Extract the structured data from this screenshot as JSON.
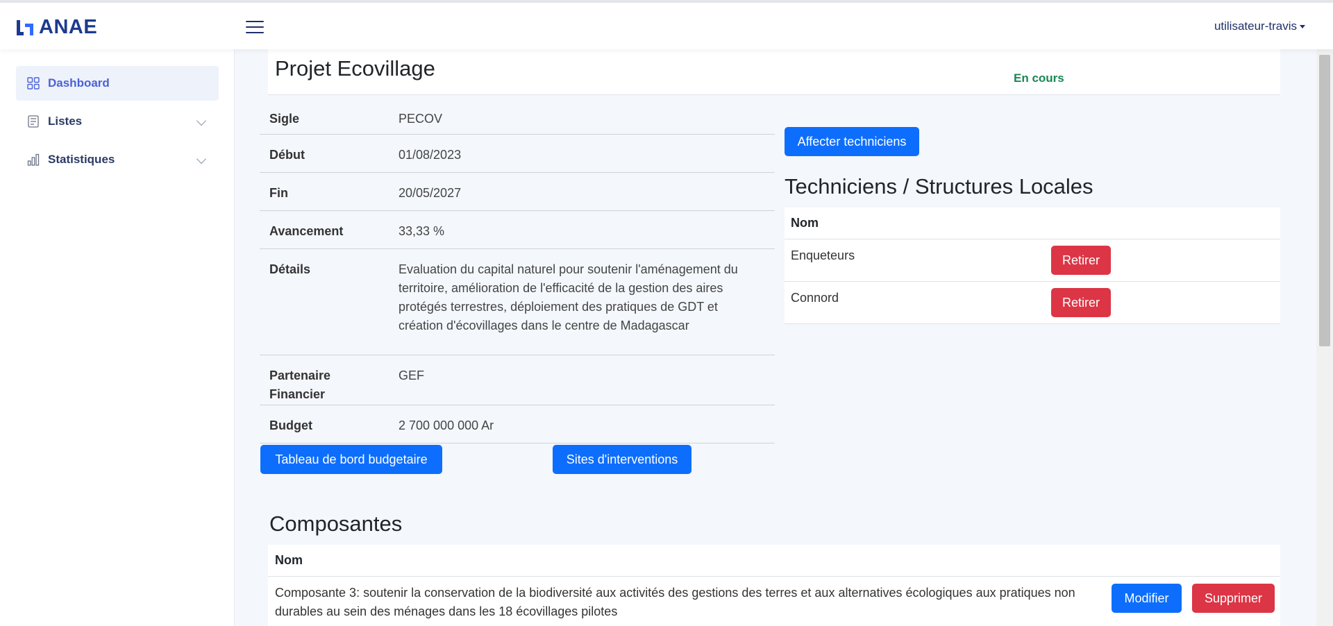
{
  "header": {
    "logo_text": "ANAE",
    "user_label": "utilisateur-travis"
  },
  "sidebar": {
    "items": [
      {
        "label": "Dashboard",
        "icon": "grid-icon",
        "active": true
      },
      {
        "label": "Listes",
        "icon": "list-icon",
        "expandable": true
      },
      {
        "label": "Statistiques",
        "icon": "bar-chart-icon",
        "expandable": true
      }
    ]
  },
  "project": {
    "title": "Projet Ecovillage",
    "status": "En cours",
    "fields": [
      {
        "label": "Sigle",
        "value": "PECOV"
      },
      {
        "label": "Début",
        "value": "01/08/2023"
      },
      {
        "label": "Fin",
        "value": "20/05/2027"
      },
      {
        "label": "Avancement",
        "value": "33,33 %"
      },
      {
        "label": "Détails",
        "value": "Evaluation du capital naturel pour soutenir l'aménagement du territoire, amélioration de l'efficacité de la gestion des aires protégés terrestres, déploiement des pratiques de GDT et création d'écovillages dans le centre de Madagascar"
      },
      {
        "label": "Partenaire Financier",
        "value": "GEF"
      },
      {
        "label": "Budget",
        "value": "2 700 000 000 Ar"
      }
    ],
    "buttons": {
      "budget_dashboard": "Tableau de bord budgetaire",
      "sites": "Sites d'interventions",
      "assign": "Affecter techniciens"
    }
  },
  "technicians": {
    "title": "Techniciens / Structures Locales",
    "column": "Nom",
    "remove_label": "Retirer",
    "rows": [
      {
        "name": "Enqueteurs"
      },
      {
        "name": "Connord"
      }
    ]
  },
  "components": {
    "title": "Composantes",
    "column": "Nom",
    "edit_label": "Modifier",
    "delete_label": "Supprimer",
    "rows": [
      {
        "name": "Composante 3: soutenir la conservation de la biodiversité aux activités des gestions des terres et aux alternatives écologiques aux pratiques non durables au sein des ménages dans les 18 écovillages pilotes"
      }
    ]
  },
  "colors": {
    "primary": "#0d6efd",
    "danger": "#dc3545",
    "success": "#198754",
    "brand": "#1d3a8f"
  }
}
